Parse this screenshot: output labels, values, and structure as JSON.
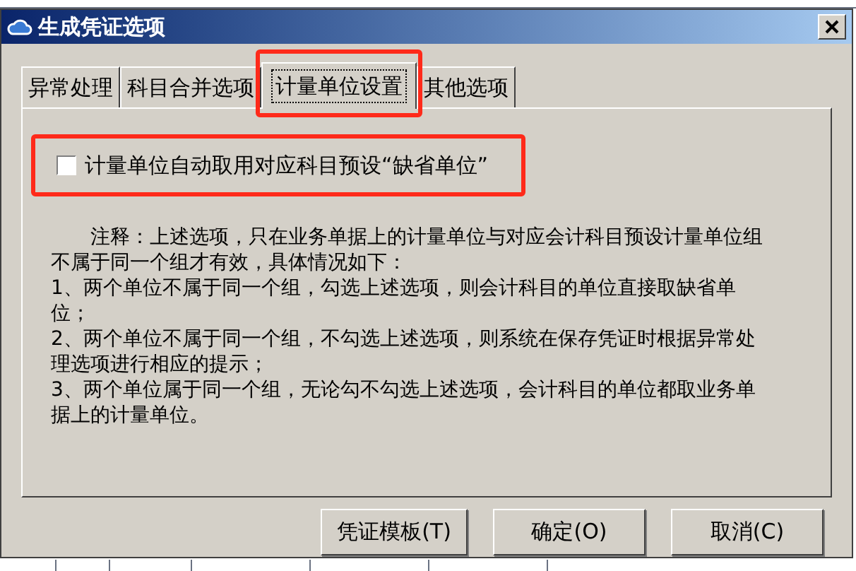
{
  "window": {
    "title": "生成凭证选项"
  },
  "tabs": [
    {
      "label": "异常处理",
      "selected": false,
      "highlighted": false
    },
    {
      "label": "科目合并选项",
      "selected": false,
      "highlighted": false
    },
    {
      "label": "计量单位设置",
      "selected": true,
      "highlighted": true
    },
    {
      "label": "其他选项",
      "selected": false,
      "highlighted": false
    }
  ],
  "option": {
    "label": "计量单位自动取用对应科目预设“缺省单位”",
    "checked": false,
    "highlighted": true
  },
  "note": [
    "　　注释：上述选项，只在业务单据上的计量单位与对应会计科目预设计量单位组不属于同一个组才有效，具体情况如下：",
    "1、两个单位不属于同一个组，勾选上述选项，则会计科目的单位直接取缺省单位；",
    "2、两个单位不属于同一个组，不勾选上述选项，则系统在保存凭证时根据异常处理选项进行相应的提示；",
    "3、两个单位属于同一个组，无论勾不勾选上述选项，会计科目的单位都取业务单据上的计量单位。"
  ],
  "buttons": [
    "凭证模板(T)",
    "确定(O)",
    "取消(C)"
  ]
}
